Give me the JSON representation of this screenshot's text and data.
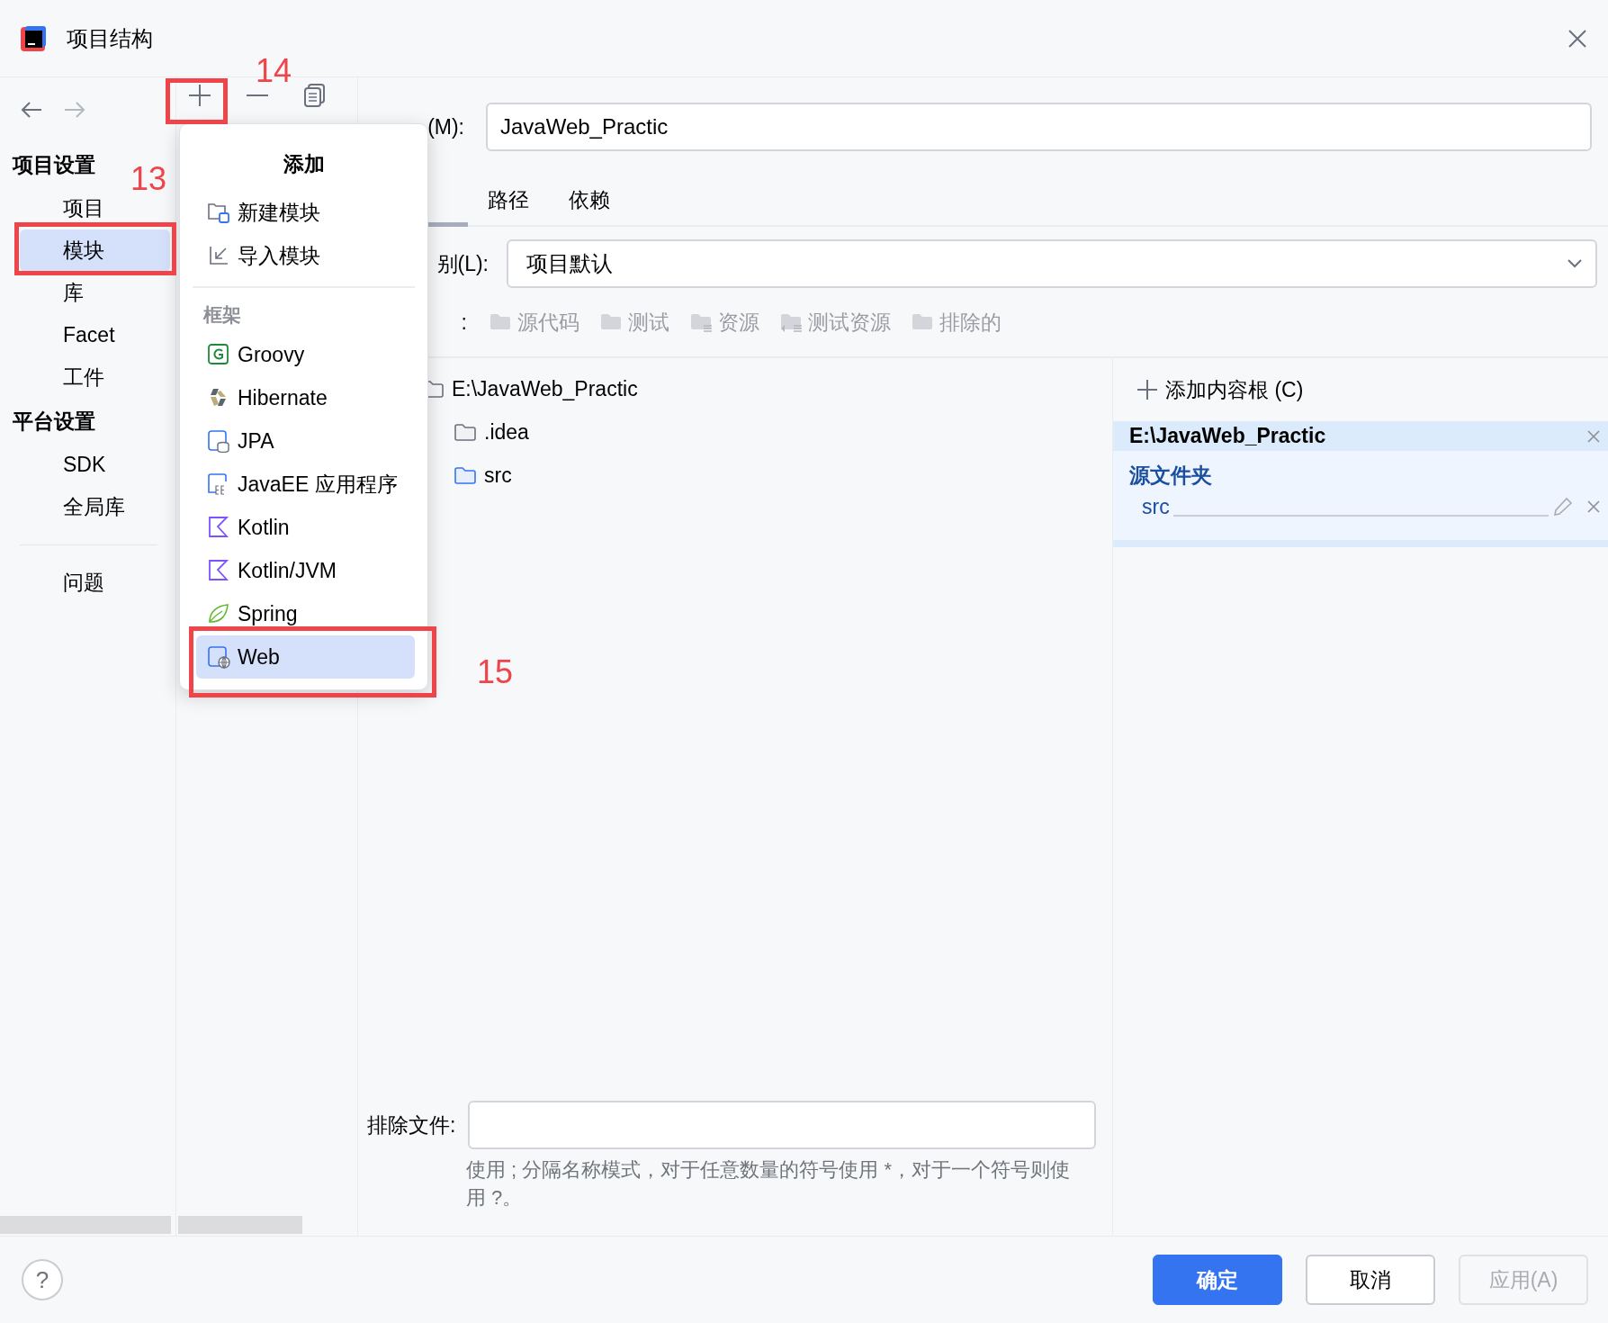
{
  "window": {
    "title": "项目结构"
  },
  "navigation": [
    {
      "kind": "back",
      "disabled": false
    },
    {
      "kind": "forward",
      "disabled": true
    }
  ],
  "tools": [
    {
      "kind": "add"
    },
    {
      "kind": "remove"
    },
    {
      "kind": "copy"
    }
  ],
  "sidebar": {
    "sections": [
      {
        "title": "项目设置",
        "items": [
          {
            "label": "项目",
            "selected": false
          },
          {
            "label": "模块",
            "selected": true
          },
          {
            "label": "库",
            "selected": false
          },
          {
            "label": "Facet",
            "selected": false
          },
          {
            "label": "工件",
            "selected": false
          }
        ]
      },
      {
        "title": "平台设置",
        "items": [
          {
            "label": "SDK",
            "selected": false
          },
          {
            "label": "全局库",
            "selected": false
          }
        ]
      },
      {
        "items": [
          {
            "label": "问题",
            "selected": false
          }
        ]
      }
    ]
  },
  "add_menu": {
    "title": "添加",
    "groups": [
      {
        "items": [
          {
            "kind": "new-module",
            "label": "新建模块",
            "selected": false
          },
          {
            "kind": "import",
            "label": "导入模块",
            "selected": false
          }
        ]
      },
      {
        "heading": "框架",
        "items": [
          {
            "kind": "groovy",
            "label": "Groovy",
            "selected": false
          },
          {
            "kind": "hibernate",
            "label": "Hibernate",
            "selected": false
          },
          {
            "kind": "jpa",
            "label": "JPA",
            "selected": false
          },
          {
            "kind": "javaee",
            "label": "JavaEE 应用程序",
            "selected": false
          },
          {
            "kind": "kotlin",
            "label": "Kotlin",
            "selected": false
          },
          {
            "kind": "kotlin",
            "label": "Kotlin/JVM",
            "selected": false
          },
          {
            "kind": "spring",
            "label": "Spring",
            "selected": false
          },
          {
            "kind": "web",
            "label": "Web",
            "selected": true
          }
        ]
      }
    ]
  },
  "module": {
    "name_label": "(M):",
    "name": "JavaWeb_Practic",
    "tabs": [
      {
        "selected": true
      },
      {
        "label": "路径",
        "selected": false
      },
      {
        "label": "依赖",
        "selected": false
      }
    ],
    "language_level": {
      "label": "别(L):",
      "value": "项目默认"
    },
    "mark_as": {
      "label": ":",
      "buttons": [
        {
          "kind": "sources",
          "label": "源代码",
          "disabled": true
        },
        {
          "kind": "tests",
          "label": "测试",
          "disabled": true
        },
        {
          "kind": "resources",
          "label": "资源",
          "disabled": true
        },
        {
          "kind": "test-resources",
          "label": "测试资源",
          "disabled": true
        },
        {
          "kind": "excluded",
          "label": "排除的",
          "disabled": true
        }
      ]
    },
    "tree": [
      {
        "kind": "module",
        "label": "E:\\JavaWeb_Practic",
        "children": [
          {
            "kind": "folder",
            "label": ".idea"
          },
          {
            "kind": "source",
            "label": "src"
          }
        ]
      }
    ],
    "content_roots": {
      "add_label": "添加内容根 (C)",
      "roots": [
        {
          "path": "E:\\JavaWeb_Practic",
          "groups": [
            {
              "heading": "源文件夹",
              "items": [
                "src"
              ]
            }
          ]
        }
      ]
    },
    "exclude": {
      "label": "排除文件:",
      "hint": "使用 ; 分隔名称模式，对于任意数量的符号使用 *，对于一个符号则使用 ?。"
    }
  },
  "footer": {
    "help_label": "?",
    "buttons": [
      {
        "kind": "primary",
        "label": "确定",
        "disabled": false
      },
      {
        "kind": "secondary",
        "label": "取消",
        "disabled": false
      },
      {
        "kind": "secondary",
        "label": "应用(A)",
        "disabled": true
      }
    ]
  },
  "annotations": [
    {
      "label": "13"
    },
    {
      "label": "14"
    },
    {
      "label": "15"
    }
  ]
}
